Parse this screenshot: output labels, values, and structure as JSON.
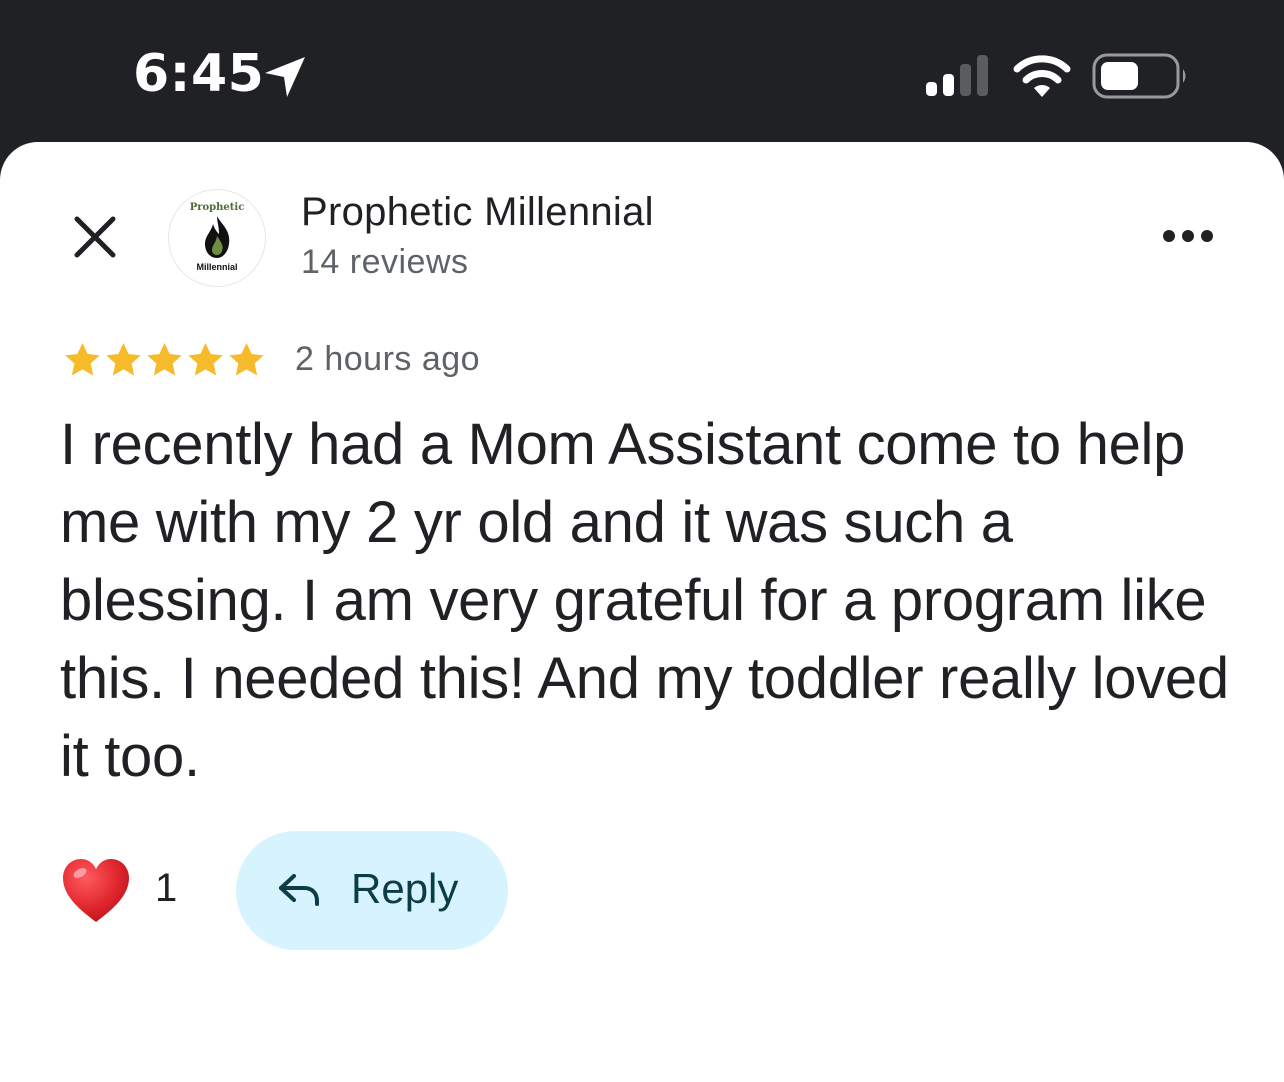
{
  "status_bar": {
    "time": "6:45",
    "icons": [
      "location-arrow-icon",
      "cellular-signal-icon",
      "wifi-icon",
      "battery-icon"
    ]
  },
  "header": {
    "close_icon": "close-icon",
    "avatar": {
      "top_text": "Prophetic",
      "bottom_text": "Millennial"
    },
    "owner_name": "Prophetic Millennial",
    "review_count": "14 reviews",
    "more_icon": "more-horizontal-icon"
  },
  "review": {
    "rating": 5,
    "max_rating": 5,
    "time_ago": "2 hours ago",
    "text": "I recently had a Mom Assistant come to help me with my 2 yr old and it was such a blessing. I am very grateful for a program like this. I needed this! And my toddler really loved it too."
  },
  "actions": {
    "heart_icon": "heart-icon",
    "like_count": "1",
    "reply_label": "Reply",
    "reply_icon": "reply-arrow-icon"
  },
  "colors": {
    "status_bar_bg": "#202124",
    "star": "#f5bb2b",
    "reply_bg": "#d7f3fd",
    "reply_text": "#0b3c47",
    "heart": "#d9202a"
  }
}
